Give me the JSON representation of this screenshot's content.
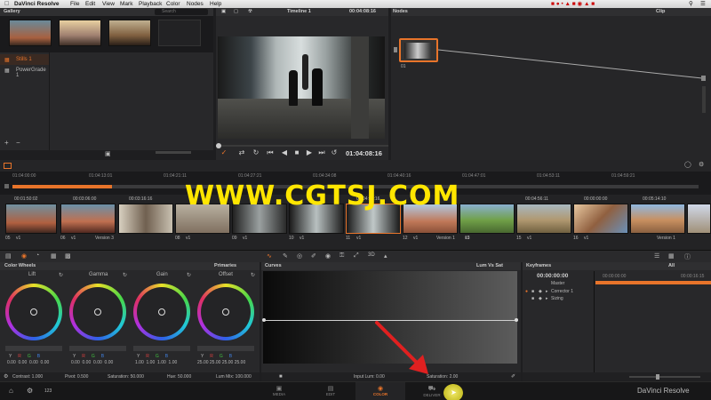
{
  "menu": {
    "app_name": "DaVinci Resolve",
    "items": [
      "File",
      "Edit",
      "View",
      "Mark",
      "Playback",
      "Color",
      "Nodes",
      "Help"
    ]
  },
  "gallery": {
    "title": "Gallery",
    "search_placeholder": "Search",
    "albums": [
      "Stills 1",
      "PowerGrade 1"
    ]
  },
  "viewer": {
    "timeline_name": "Timeline 1",
    "timecode_top": "00:04:08:16",
    "timecode": "01:04:08:16"
  },
  "nodes": {
    "title": "Nodes",
    "mode": "Clip",
    "node_label": "01"
  },
  "timeline_ruler": [
    "01:04:00:00",
    "01:04:13:01",
    "01:04:21:11",
    "01:04:27:21",
    "01:04:34:08",
    "01:04:40:16",
    "01:04:47:01",
    "01:04:53:11",
    "01:04:59:21"
  ],
  "clips": [
    {
      "tc": "00:01:50:02",
      "num": "05",
      "label": "v1"
    },
    {
      "tc": "00:03:06:00",
      "num": "06",
      "label": "v1"
    },
    {
      "tc": "00:03:16:16",
      "num": "07",
      "label": "Version 3"
    },
    {
      "tc": "",
      "num": "08",
      "label": "v1"
    },
    {
      "tc": "",
      "num": "09",
      "label": "v1"
    },
    {
      "tc": "",
      "num": "10",
      "label": "v1"
    },
    {
      "tc": "00:04:08:16",
      "num": "11",
      "label": "v1"
    },
    {
      "tc": "",
      "num": "12",
      "label": "v1"
    },
    {
      "tc": "",
      "num": "13",
      "label": "Version 1"
    },
    {
      "tc": "",
      "num": "14",
      "label": "v1"
    },
    {
      "tc": "00:04:56:11",
      "num": "15",
      "label": "v1"
    },
    {
      "tc": "00:00:00:00",
      "num": "16",
      "label": "v1"
    },
    {
      "tc": "00:05:14:10",
      "num": "17",
      "label": "Version 1"
    }
  ],
  "watermark": "WWW.CGTSJ.COM",
  "color_wheels": {
    "title": "Color Wheels",
    "mode": "Primaries",
    "wheels": [
      {
        "name": "Lift",
        "values": [
          "0.00",
          "0.00",
          "0.00",
          "0.00"
        ]
      },
      {
        "name": "Gamma",
        "values": [
          "0.00",
          "0.00",
          "0.00",
          "0.00"
        ]
      },
      {
        "name": "Gain",
        "values": [
          "1.00",
          "1.00",
          "1.00",
          "1.00"
        ]
      },
      {
        "name": "Offset",
        "values": [
          "25.00",
          "25.00",
          "25.00",
          "25.00"
        ]
      }
    ],
    "channel_labels": [
      "Y",
      "R",
      "G",
      "B"
    ],
    "footer": {
      "contrast": "Contrast: 1.000",
      "pivot": "Pivot: 0.500",
      "saturation": "Saturation: 50.000",
      "hue": "Hue: 50.000",
      "lum_mix": "Lum Mix: 100.000"
    }
  },
  "curves": {
    "title": "Curves",
    "mode": "Lum Vs Sat",
    "input_lum": "Input Lum: 0.00",
    "saturation": "Saturation: 2.00"
  },
  "keyframes": {
    "title": "Keyframes",
    "filter": "All",
    "timecode": "00:00:00:00",
    "ruler_start": "00:00:00:00",
    "ruler_end": "00:00:16:15",
    "tracks": [
      "Master",
      "Corrector 1",
      "Sizing"
    ]
  },
  "bottom_tabs": [
    "MEDIA",
    "EDIT",
    "COLOR",
    "DELIVER"
  ],
  "bottom_right": "DaVinci Resolve",
  "bottom_count": "123",
  "colors": {
    "accent": "#e8742a",
    "watermark": "#ffe600",
    "arrow": "#e02020"
  }
}
